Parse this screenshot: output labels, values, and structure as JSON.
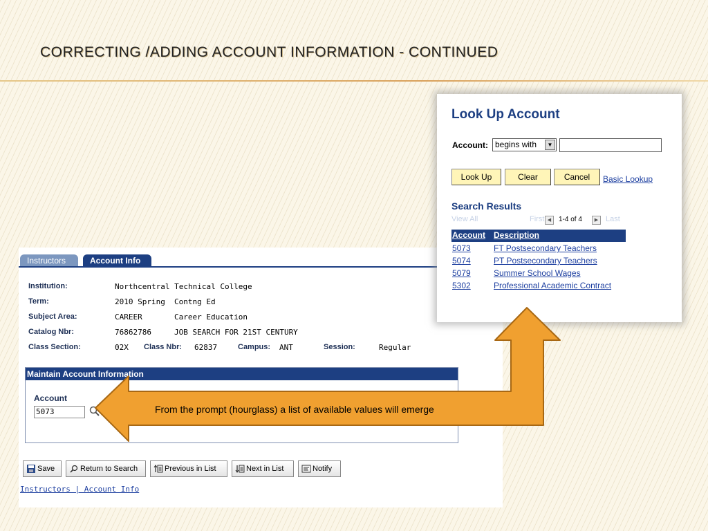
{
  "slide": {
    "title": "CORRECTING /ADDING ACCOUNT INFORMATION - CONTINUED"
  },
  "tabs": [
    {
      "label": "Instructors",
      "active": false
    },
    {
      "label": "Account Info",
      "active": true
    }
  ],
  "info": {
    "institution_label": "Institution:",
    "institution_value": "Northcentral Technical College",
    "term_label": "Term:",
    "term_value": "2010 Spring",
    "term_desc": "Contng Ed",
    "subject_label": "Subject Area:",
    "subject_value": "CAREER",
    "subject_desc": "Career Education",
    "catalog_label": "Catalog Nbr:",
    "catalog_value": "76862786",
    "catalog_desc": "JOB SEARCH FOR 21ST CENTURY",
    "section_label": "Class Section:",
    "section_value": "02X",
    "classnbr_label": "Class Nbr:",
    "classnbr_value": "62837",
    "campus_label": "Campus:",
    "campus_value": "ANT",
    "session_label": "Session:",
    "session_value": "Regular"
  },
  "maintain": {
    "header": "Maintain Account Information",
    "account_label": "Account",
    "account_value": "5073"
  },
  "toolbar": {
    "save": "Save",
    "return": "Return to Search",
    "previous": "Previous in List",
    "next": "Next in List",
    "notify": "Notify"
  },
  "footer": {
    "links": "Instructors | Account Info"
  },
  "lookup": {
    "title": "Look Up Account",
    "account_label": "Account:",
    "operator": "begins with",
    "search_value": "",
    "lookup_button": "Look Up",
    "clear_button": "Clear",
    "cancel_button": "Cancel",
    "basic_lookup": "Basic Lookup",
    "results_title": "Search Results",
    "view_all": "View All",
    "first": "First",
    "last": "Last",
    "count": "1-4 of 4",
    "col_account": "Account",
    "col_description": "Description",
    "rows": [
      {
        "account": "5073",
        "description": "FT Postsecondary Teachers"
      },
      {
        "account": "5074",
        "description": "PT Postsecondary Teachers"
      },
      {
        "account": "5079",
        "description": "Summer School Wages"
      },
      {
        "account": "5302",
        "description": "Professional Academic Contract"
      }
    ]
  },
  "callout": {
    "text": "From the prompt (hourglass) a list of available values will  emerge"
  },
  "colors": {
    "peoplesoft_blue": "#1d3f82",
    "arrow_orange": "#f0a030",
    "button_yellow": "#fff5b8"
  }
}
